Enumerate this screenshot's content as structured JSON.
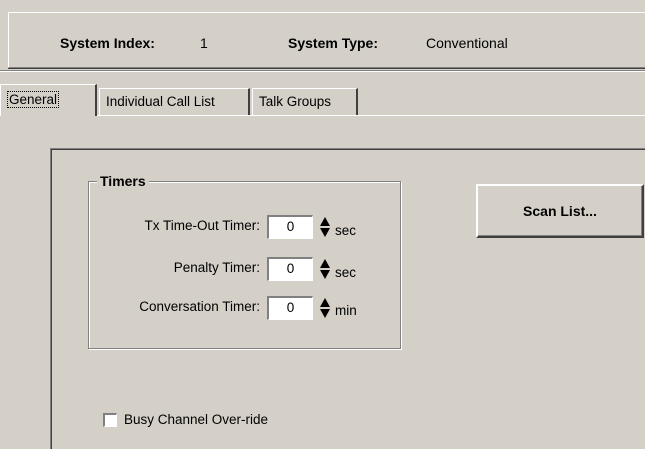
{
  "header": {
    "system_index_label": "System Index:",
    "system_index_value": "1",
    "system_type_label": "System Type:",
    "system_type_value": "Conventional"
  },
  "tabs": [
    {
      "label": "General",
      "active": true
    },
    {
      "label": "Individual Call List",
      "active": false
    },
    {
      "label": "Talk Groups",
      "active": false
    }
  ],
  "timers": {
    "title": "Timers",
    "rows": [
      {
        "label": "Tx Time-Out Timer:",
        "value": "0",
        "unit": "sec"
      },
      {
        "label": "Penalty Timer:",
        "value": "0",
        "unit": "sec"
      },
      {
        "label": "Conversation Timer:",
        "value": "0",
        "unit": "min"
      }
    ]
  },
  "scan_list_button": "Scan List...",
  "busy_channel": {
    "label": "Busy Channel Over-ride",
    "checked": false
  }
}
